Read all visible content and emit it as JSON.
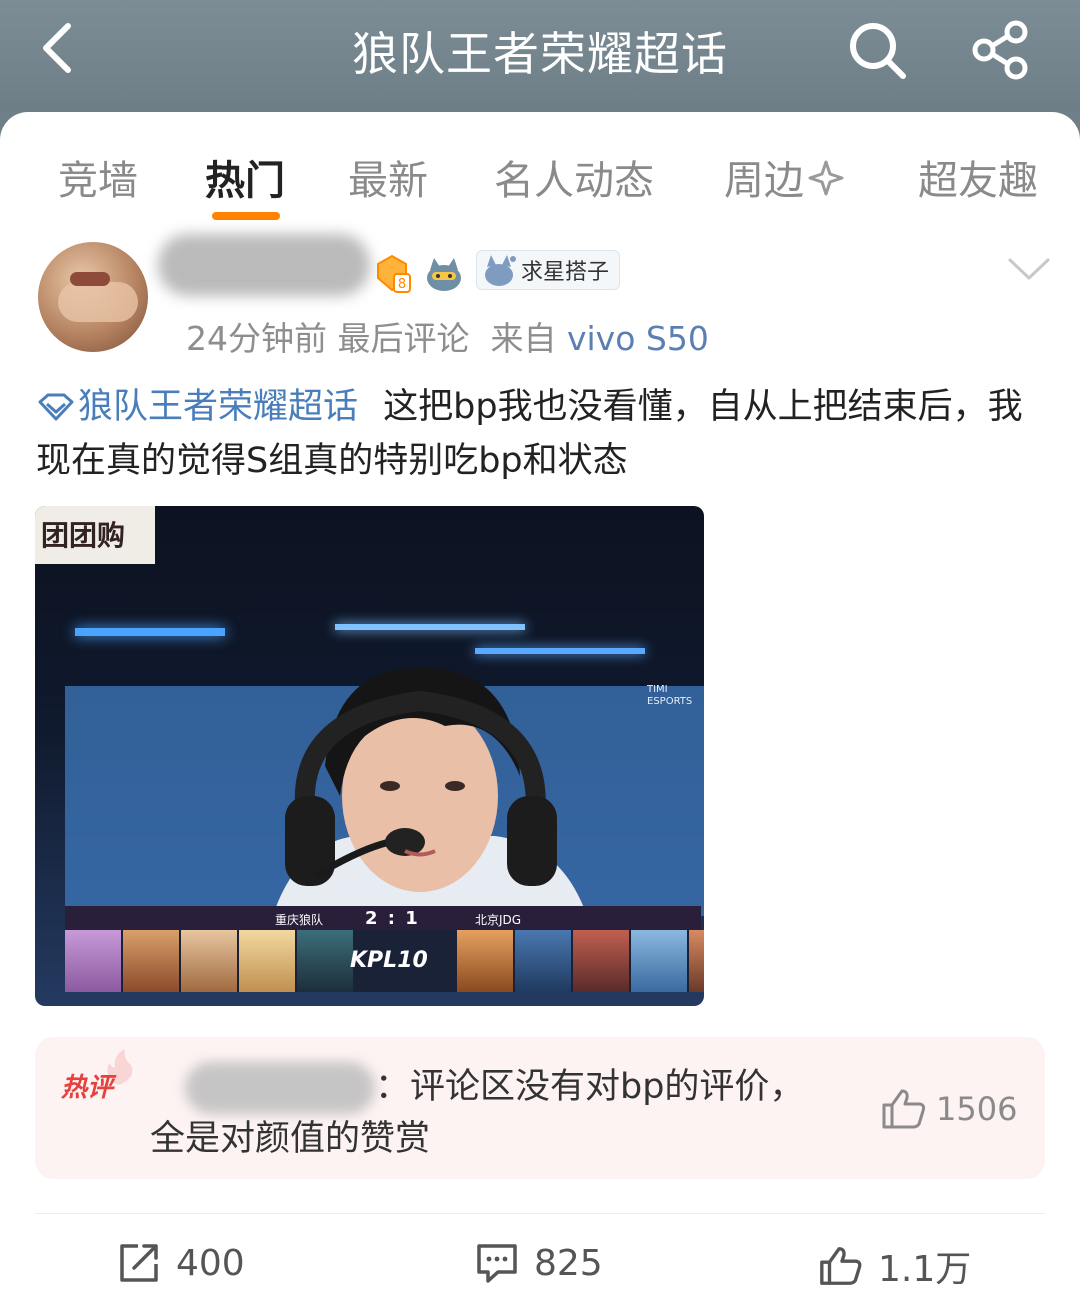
{
  "header": {
    "title": "狼队王者荣耀超话"
  },
  "tabs": [
    {
      "label": "竞墙"
    },
    {
      "label": "热门"
    },
    {
      "label": "最新"
    },
    {
      "label": "名人动态"
    },
    {
      "label": "周边"
    },
    {
      "label": "超友趣"
    }
  ],
  "active_tab": "热门",
  "post": {
    "badge_star_label": "求星搭子",
    "badge_level": "8",
    "time": "24分钟前",
    "last_comment": "最后评论",
    "source_prefix": "来自",
    "device": "vivo S50",
    "topic": "狼队王者荣耀超话",
    "text": "这把bp我也没看懂，自从上把结束后，我现在真的觉得S组真的特别吃bp和状态",
    "image": {
      "sign_text": "团团购",
      "logo_text": "TIMI ESPORTS",
      "team_left": "重庆狼队",
      "score": "2 : 1",
      "team_right": "北京JDG",
      "league": "KPL10"
    }
  },
  "hot_comment": {
    "label": "热评",
    "text": "：评论区没有对bp的评价，全是对颜值的赞赏",
    "likes": "1506"
  },
  "actions": {
    "reposts": "400",
    "comments": "825",
    "likes": "1.1万"
  },
  "colors": {
    "accent": "#ff8200",
    "link": "#4a7ebb",
    "hot": "#e8413d"
  }
}
